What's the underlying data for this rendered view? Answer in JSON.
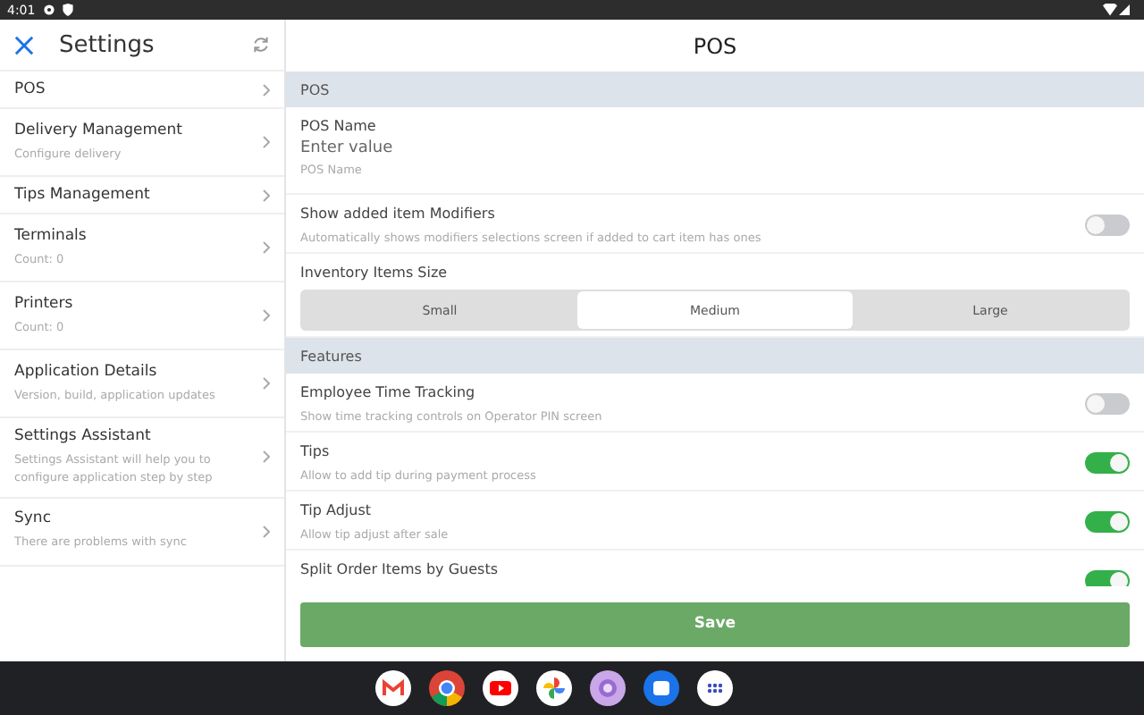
{
  "status_bar": {
    "time": "4:01"
  },
  "sidebar": {
    "title": "Settings",
    "items": [
      {
        "label": "POS"
      },
      {
        "label": "Delivery Management",
        "subtitle": "Configure delivery"
      },
      {
        "label": "Tips Management"
      },
      {
        "label": "Terminals",
        "subtitle": "Count: 0"
      },
      {
        "label": "Printers",
        "subtitle": "Count: 0"
      },
      {
        "label": "Application Details",
        "subtitle": "Version, build, application updates"
      },
      {
        "label": "Settings Assistant",
        "subtitle": "Settings Assistant will help you to configure application step by step"
      },
      {
        "label": "Sync",
        "subtitle": "There are problems with sync"
      }
    ]
  },
  "panel": {
    "title": "POS",
    "sections": [
      {
        "header": "POS",
        "items": [
          {
            "kind": "field",
            "label": "POS Name",
            "placeholder": "Enter value",
            "helper": "POS Name"
          },
          {
            "kind": "toggle",
            "label": "Show added item Modifiers",
            "description": "Automatically shows modifiers selections screen if added to cart item has ones",
            "on": false
          },
          {
            "kind": "segmented",
            "label": "Inventory Items Size",
            "options": [
              {
                "label": "Small",
                "selected": false
              },
              {
                "label": "Medium",
                "selected": true
              },
              {
                "label": "Large",
                "selected": false
              }
            ]
          }
        ]
      },
      {
        "header": "Features",
        "items": [
          {
            "kind": "toggle",
            "label": "Employee Time Tracking",
            "description": "Show time tracking controls on Operator PIN screen",
            "on": false
          },
          {
            "kind": "toggle",
            "label": "Tips",
            "description": "Allow to add tip during payment process",
            "on": true
          },
          {
            "kind": "toggle",
            "label": "Tip Adjust",
            "description": "Allow tip adjust after sale",
            "on": true
          },
          {
            "kind": "toggle",
            "label": "Split Order Items by Guests",
            "on": true
          }
        ]
      }
    ],
    "save_button": "Save"
  }
}
